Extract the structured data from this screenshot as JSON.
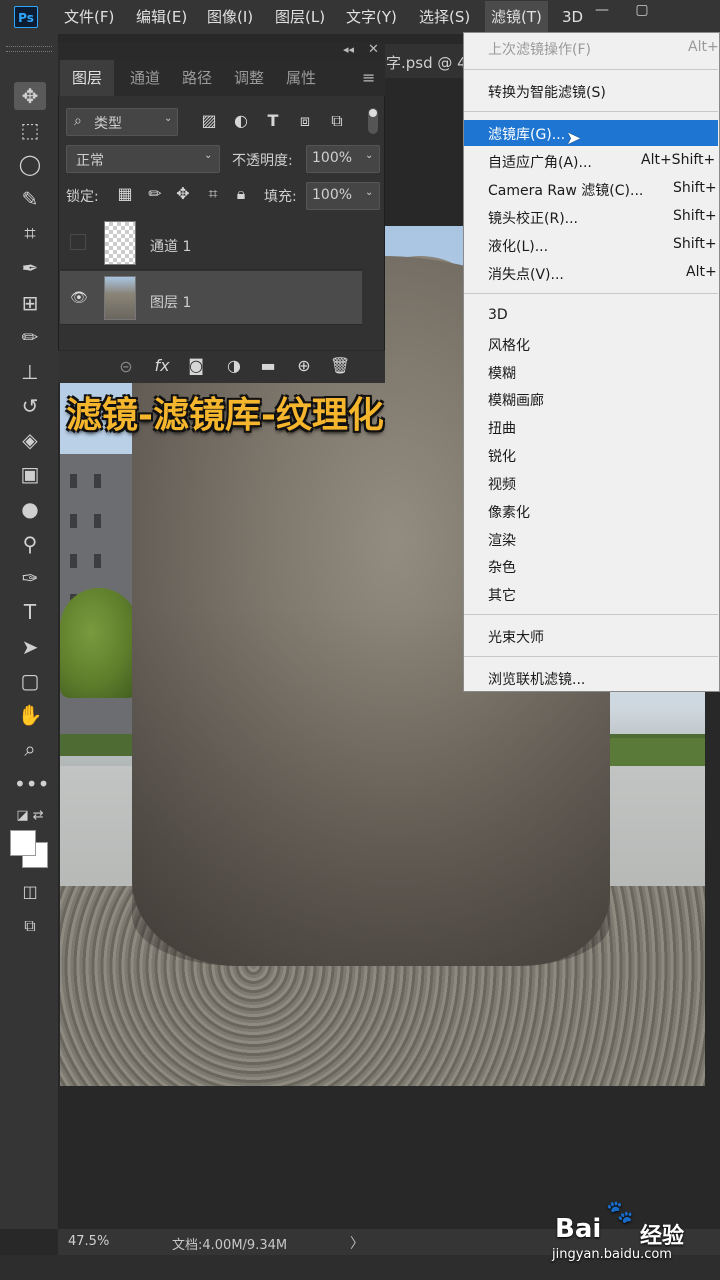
{
  "menubar": {
    "logo": "Ps",
    "items": [
      "文件(F)",
      "编辑(E)",
      "图像(I)",
      "图层(L)",
      "文字(Y)",
      "选择(S)",
      "滤镜(T)",
      "3D"
    ]
  },
  "document": {
    "tab_title": "字.psd @ 4"
  },
  "layers_panel": {
    "tabs": [
      "图层",
      "通道",
      "路径",
      "调整",
      "属性"
    ],
    "filter_kind": "类型",
    "blend_mode": "正常",
    "opacity_label": "不透明度:",
    "opacity_value": "100%",
    "lock_label": "锁定:",
    "fill_label": "填充:",
    "fill_value": "100%",
    "layers": [
      {
        "name": "通道 1",
        "visible": false
      },
      {
        "name": "图层 1",
        "visible": true,
        "selected": true
      }
    ],
    "footer_icons": [
      "link-icon",
      "fx-icon",
      "mask-icon",
      "adjustment-icon",
      "folder-icon",
      "new-layer-icon",
      "trash-icon"
    ]
  },
  "filter_menu": {
    "last_filter": "上次滤镜操作(F)",
    "last_filter_shortcut": "Alt+",
    "convert_smart": "转换为智能滤镜(S)",
    "gallery": "滤镜库(G)...",
    "adaptive_wide": "自适应广角(A)...",
    "adaptive_wide_shortcut": "Alt+Shift+",
    "camera_raw": "Camera Raw 滤镜(C)...",
    "camera_raw_shortcut": "Shift+",
    "lens_correction": "镜头校正(R)...",
    "lens_correction_shortcut": "Shift+",
    "liquify": "液化(L)...",
    "liquify_shortcut": "Shift+",
    "vanishing_point": "消失点(V)...",
    "vanishing_point_shortcut": "Alt+",
    "categories": [
      "3D",
      "风格化",
      "模糊",
      "模糊画廊",
      "扭曲",
      "锐化",
      "视频",
      "像素化",
      "渲染",
      "杂色",
      "其它"
    ],
    "plugin": "光束大师",
    "browse_online": "浏览联机滤镜..."
  },
  "caption": "滤镜-滤镜库-纹理化",
  "status": {
    "zoom": "47.5%",
    "doc_info": "文档:4.00M/9.34M",
    "arrow": "〉"
  },
  "watermark": {
    "logo": "Bai",
    "paw": "🐾",
    "cn": "经验",
    "url": "jingyan.baidu.com"
  },
  "tools": [
    "move-tool",
    "marquee-tool",
    "lasso-tool",
    "quick-select-tool",
    "crop-tool",
    "eyedropper-tool",
    "patch-tool",
    "brush-tool",
    "stamp-tool",
    "history-brush-tool",
    "eraser-tool",
    "gradient-tool",
    "blur-tool",
    "dodge-tool",
    "pen-tool",
    "type-tool",
    "path-select-tool",
    "shape-tool",
    "hand-tool",
    "zoom-tool",
    "more-tools"
  ],
  "colors": {
    "menu_highlight": "#1e76d2",
    "caption": "#f5b52c",
    "panel": "#323232"
  }
}
